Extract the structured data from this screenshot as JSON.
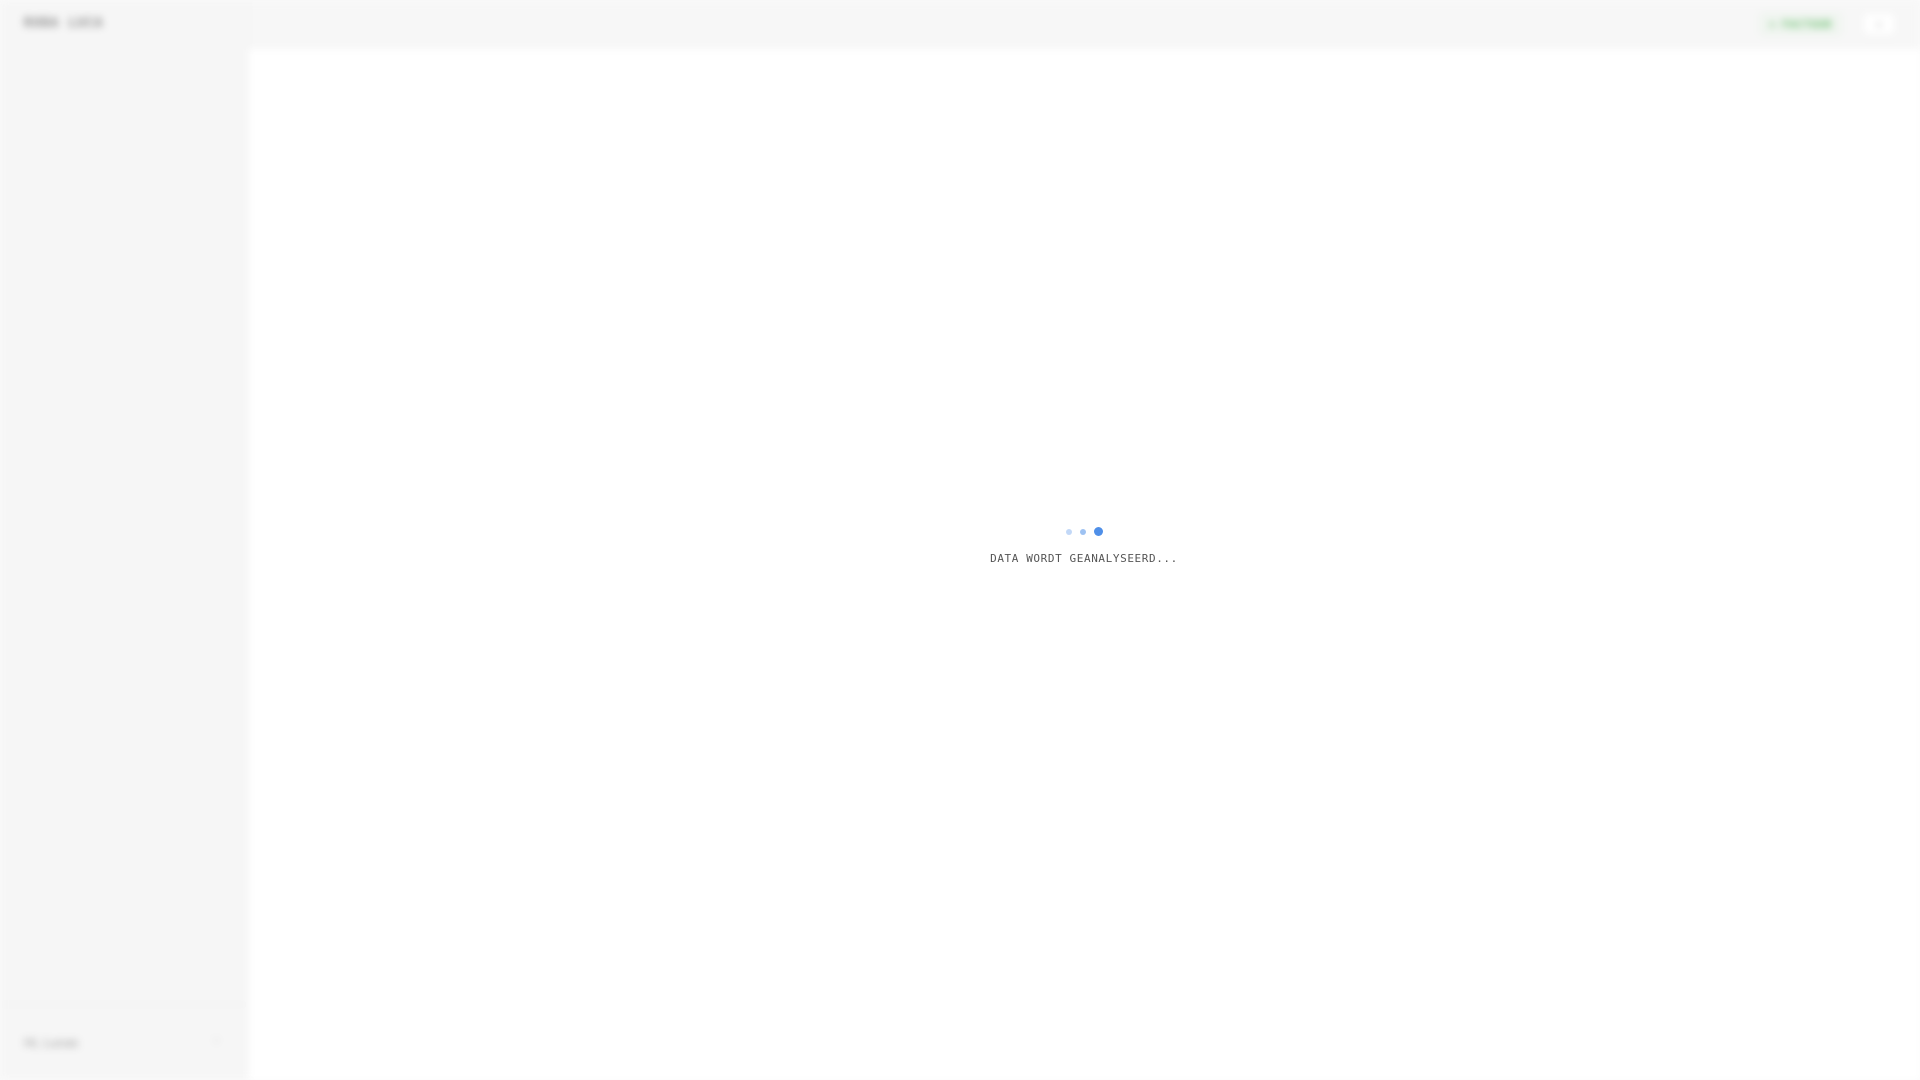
{
  "sidebar": {
    "brand": "ROBA LUCA",
    "footer": {
      "greeting": "Hi, Lucas",
      "chevron_icon": "chevron-right-icon"
    }
  },
  "topbar": {
    "factuur_button": {
      "icon": "plus-icon",
      "icon_glyph": "+",
      "label": "FACTUUR"
    },
    "close_button": {
      "icon": "close-icon",
      "glyph": "×"
    }
  },
  "loader": {
    "message": "DATA WORDT GEANALYSEERD...",
    "dot_color": "#4f8fe8"
  },
  "colors": {
    "accent_green": "#6fbf73",
    "accent_blue": "#4f8fe8"
  }
}
